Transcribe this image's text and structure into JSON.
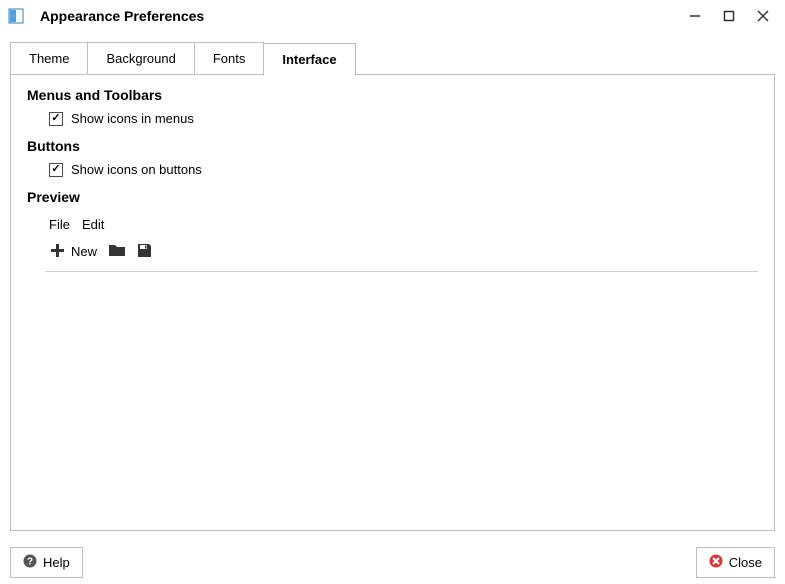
{
  "window": {
    "title": "Appearance Preferences"
  },
  "tabs": {
    "theme": "Theme",
    "background": "Background",
    "fonts": "Fonts",
    "interface": "Interface",
    "active": "interface"
  },
  "sections": {
    "menus_toolbars": {
      "title": "Menus and Toolbars",
      "show_icons_in_menus": {
        "label": "Show icons in menus",
        "checked": true
      }
    },
    "buttons": {
      "title": "Buttons",
      "show_icons_on_buttons": {
        "label": "Show icons on buttons",
        "checked": true
      }
    },
    "preview": {
      "title": "Preview",
      "menu": {
        "file": "File",
        "edit": "Edit"
      },
      "toolbar": {
        "new": "New"
      }
    }
  },
  "footer": {
    "help": "Help",
    "close": "Close"
  }
}
